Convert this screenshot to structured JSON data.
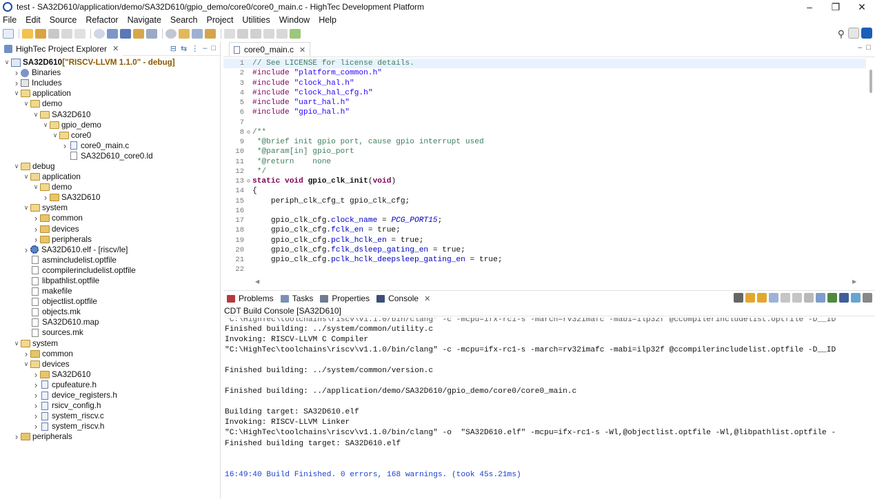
{
  "window": {
    "title": "test - SA32D610/application/demo/SA32D610/gpio_demo/core0/core0_main.c - HighTec Development Platform"
  },
  "menu": [
    "File",
    "Edit",
    "Source",
    "Refactor",
    "Navigate",
    "Search",
    "Project",
    "Utilities",
    "Window",
    "Help"
  ],
  "explorer": {
    "tab_label": "HighTec Project Explorer",
    "items": [
      {
        "label": "SA32D610",
        "suffix": " [\"RISCV-LLVM 1.1.0\" - debug]",
        "level": 0,
        "expand": "open",
        "type": "project"
      },
      {
        "label": "Binaries",
        "level": 1,
        "expand": "closed",
        "type": "binaries"
      },
      {
        "label": "Includes",
        "level": 1,
        "expand": "closed",
        "type": "includes"
      },
      {
        "label": "application",
        "level": 1,
        "expand": "open",
        "type": "folder"
      },
      {
        "label": "demo",
        "level": 2,
        "expand": "open",
        "type": "folder"
      },
      {
        "label": "SA32D610",
        "level": 3,
        "expand": "open",
        "type": "folder"
      },
      {
        "label": "gpio_demo",
        "level": 4,
        "expand": "open",
        "type": "folder"
      },
      {
        "label": "core0",
        "level": 5,
        "expand": "open",
        "type": "folder"
      },
      {
        "label": "core0_main.c",
        "level": 6,
        "expand": "closed",
        "type": "cfile"
      },
      {
        "label": "SA32D610_core0.ld",
        "level": 6,
        "expand": "none",
        "type": "file"
      },
      {
        "label": "debug",
        "level": 1,
        "expand": "open",
        "type": "folder"
      },
      {
        "label": "application",
        "level": 2,
        "expand": "open",
        "type": "folder"
      },
      {
        "label": "demo",
        "level": 3,
        "expand": "open",
        "type": "folder"
      },
      {
        "label": "SA32D610",
        "level": 4,
        "expand": "closed",
        "type": "folder"
      },
      {
        "label": "system",
        "level": 2,
        "expand": "open",
        "type": "folder"
      },
      {
        "label": "common",
        "level": 3,
        "expand": "closed",
        "type": "folder"
      },
      {
        "label": "devices",
        "level": 3,
        "expand": "closed",
        "type": "folder"
      },
      {
        "label": "peripherals",
        "level": 3,
        "expand": "closed",
        "type": "folder"
      },
      {
        "label": "SA32D610.elf - [riscv/le]",
        "level": 2,
        "expand": "closed",
        "type": "elf"
      },
      {
        "label": "asmincludelist.optfile",
        "level": 2,
        "expand": "none",
        "type": "file"
      },
      {
        "label": "ccompilerincludelist.optfile",
        "level": 2,
        "expand": "none",
        "type": "file"
      },
      {
        "label": "libpathlist.optfile",
        "level": 2,
        "expand": "none",
        "type": "file"
      },
      {
        "label": "makefile",
        "level": 2,
        "expand": "none",
        "type": "file"
      },
      {
        "label": "objectlist.optfile",
        "level": 2,
        "expand": "none",
        "type": "file"
      },
      {
        "label": "objects.mk",
        "level": 2,
        "expand": "none",
        "type": "file"
      },
      {
        "label": "SA32D610.map",
        "level": 2,
        "expand": "none",
        "type": "file"
      },
      {
        "label": "sources.mk",
        "level": 2,
        "expand": "none",
        "type": "file"
      },
      {
        "label": "system",
        "level": 1,
        "expand": "open",
        "type": "folder"
      },
      {
        "label": "common",
        "level": 2,
        "expand": "closed",
        "type": "folder"
      },
      {
        "label": "devices",
        "level": 2,
        "expand": "open",
        "type": "folder"
      },
      {
        "label": "SA32D610",
        "level": 3,
        "expand": "closed",
        "type": "folder"
      },
      {
        "label": "cpufeature.h",
        "level": 3,
        "expand": "closed",
        "type": "cfile"
      },
      {
        "label": "device_registers.h",
        "level": 3,
        "expand": "closed",
        "type": "cfile"
      },
      {
        "label": "rsicv_config.h",
        "level": 3,
        "expand": "closed",
        "type": "cfile"
      },
      {
        "label": "system_riscv.c",
        "level": 3,
        "expand": "closed",
        "type": "cfile"
      },
      {
        "label": "system_riscv.h",
        "level": 3,
        "expand": "closed",
        "type": "cfile"
      },
      {
        "label": "peripherals",
        "level": 1,
        "expand": "closed",
        "type": "folder"
      }
    ]
  },
  "editor": {
    "tab_label": "core0_main.c",
    "lines": [
      {
        "n": "1",
        "t": [
          [
            "cm",
            "// See LICENSE for license details."
          ]
        ]
      },
      {
        "n": "2",
        "t": [
          [
            "pp",
            "#include "
          ],
          [
            "str",
            "\"platform_common.h\""
          ]
        ]
      },
      {
        "n": "3",
        "t": [
          [
            "pp",
            "#include "
          ],
          [
            "str",
            "\"clock_hal.h\""
          ]
        ]
      },
      {
        "n": "4",
        "t": [
          [
            "pp",
            "#include "
          ],
          [
            "str",
            "\"clock_hal_cfg.h\""
          ]
        ]
      },
      {
        "n": "5",
        "t": [
          [
            "pp",
            "#include "
          ],
          [
            "str",
            "\"uart_hal.h\""
          ]
        ]
      },
      {
        "n": "6",
        "t": [
          [
            "pp",
            "#include "
          ],
          [
            "str",
            "\"gpio_hal.h\""
          ]
        ]
      },
      {
        "n": "7",
        "t": []
      },
      {
        "n": "8",
        "fold": true,
        "t": [
          [
            "cm",
            "/**"
          ]
        ]
      },
      {
        "n": "9",
        "t": [
          [
            "cm",
            " *@brief init gpio port, cause gpio interrupt used"
          ]
        ]
      },
      {
        "n": "10",
        "t": [
          [
            "cm",
            " *@param[in] gpio_port"
          ]
        ]
      },
      {
        "n": "11",
        "t": [
          [
            "cm",
            " *@return    none"
          ]
        ]
      },
      {
        "n": "12",
        "t": [
          [
            "cm",
            " */"
          ]
        ]
      },
      {
        "n": "13",
        "fold": true,
        "t": [
          [
            "k",
            "static void "
          ],
          [
            "fn",
            "gpio_clk_init"
          ],
          [
            "",
            "("
          ],
          [
            "k",
            "void"
          ],
          [
            "",
            ")"
          ]
        ]
      },
      {
        "n": "14",
        "t": [
          [
            "",
            "{"
          ]
        ]
      },
      {
        "n": "15",
        "t": [
          [
            "",
            "    periph_clk_cfg_t gpio_clk_cfg;"
          ]
        ]
      },
      {
        "n": "16",
        "t": []
      },
      {
        "n": "17",
        "t": [
          [
            "",
            "    gpio_clk_cfg."
          ],
          [
            "fld",
            "clock_name"
          ],
          [
            "",
            " = "
          ],
          [
            "itl",
            "PCG_PORT15"
          ],
          [
            "",
            ";"
          ]
        ]
      },
      {
        "n": "18",
        "t": [
          [
            "",
            "    gpio_clk_cfg."
          ],
          [
            "fld",
            "fclk_en"
          ],
          [
            "",
            " = true;"
          ]
        ]
      },
      {
        "n": "19",
        "t": [
          [
            "",
            "    gpio_clk_cfg."
          ],
          [
            "fld",
            "pclk_hclk_en"
          ],
          [
            "",
            " = true;"
          ]
        ]
      },
      {
        "n": "20",
        "t": [
          [
            "",
            "    gpio_clk_cfg."
          ],
          [
            "fld",
            "fclk_dsleep_gating_en"
          ],
          [
            "",
            " = true;"
          ]
        ]
      },
      {
        "n": "21",
        "t": [
          [
            "",
            "    gpio_clk_cfg."
          ],
          [
            "fld",
            "pclk_hclk_deepsleep_gating_en"
          ],
          [
            "",
            " = true;"
          ]
        ]
      },
      {
        "n": "22",
        "t": []
      }
    ]
  },
  "console": {
    "tabs": [
      {
        "label": "Problems",
        "color": "#b33b3b"
      },
      {
        "label": "Tasks",
        "color": "#7a8fb5"
      },
      {
        "label": "Properties",
        "color": "#6e7c91"
      },
      {
        "label": "Console",
        "color": "#3c4f78"
      }
    ],
    "subtitle": "CDT Build Console [SA32D610]",
    "lines": [
      {
        "t": "\"C:\\HighTec\\toolchains\\riscv\\v1.1.0/bin/clang\" -c -mcpu=ifx-rc1-s -march=rv32imafc -mabi=ilp32f @ccompilerincludelist.optfile -D__ID",
        "cls": "cut"
      },
      {
        "t": "Finished building: ../system/common/utility.c",
        "cls": ""
      },
      {
        "t": "Invoking: RISCV-LLVM C Compiler",
        "cls": ""
      },
      {
        "t": "\"C:\\HighTec\\toolchains\\riscv\\v1.1.0/bin/clang\" -c -mcpu=ifx-rc1-s -march=rv32imafc -mabi=ilp32f @ccompilerincludelist.optfile -D__ID",
        "cls": ""
      },
      {
        "t": "",
        "cls": ""
      },
      {
        "t": "Finished building: ../system/common/version.c",
        "cls": ""
      },
      {
        "t": "",
        "cls": ""
      },
      {
        "t": "Finished building: ../application/demo/SA32D610/gpio_demo/core0/core0_main.c",
        "cls": ""
      },
      {
        "t": "",
        "cls": ""
      },
      {
        "t": "Building target: SA32D610.elf",
        "cls": ""
      },
      {
        "t": "Invoking: RISCV-LLVM Linker",
        "cls": ""
      },
      {
        "t": "\"C:\\HighTec\\toolchains\\riscv\\v1.1.0/bin/clang\" -o  \"SA32D610.elf\" -mcpu=ifx-rc1-s -Wl,@objectlist.optfile -Wl,@libpathlist.optfile -",
        "cls": ""
      },
      {
        "t": "Finished building target: SA32D610.elf",
        "cls": ""
      },
      {
        "t": "",
        "cls": ""
      },
      {
        "t": "",
        "cls": ""
      },
      {
        "t": "16:49:40 Build Finished. 0 errors, 168 warnings. (took 45s.21ms)",
        "cls": "blue"
      }
    ]
  },
  "colors": {
    "accent": "#1b4f9c",
    "folder": "#e8c46a",
    "console_finish": "#1a3fd0"
  }
}
